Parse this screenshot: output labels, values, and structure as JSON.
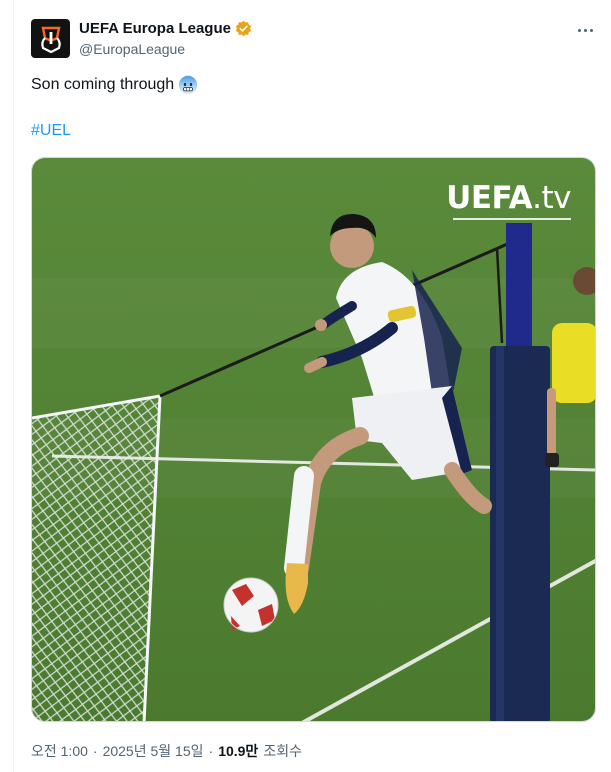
{
  "author": {
    "display_name": "UEFA Europa League",
    "handle": "@EuropaLeague",
    "verified_badge_color": "#e8a317"
  },
  "tweet": {
    "text": "Son coming through",
    "emoji": "face-with-cold-sweat-emoji",
    "hashtag": "#UEL"
  },
  "media": {
    "watermark_bold": "UEFA",
    "watermark_light": ".tv",
    "alt": "",
    "pitch_color": "#4a7a2e"
  },
  "meta": {
    "time": "오전 1:00",
    "sep1": "·",
    "date": "2025년 5월 15일",
    "sep2": "·",
    "views_count": "10.9만",
    "views_label": "조회수"
  },
  "colors": {
    "link": "#1d9bf0",
    "muted": "#536471",
    "text": "#0f1419"
  }
}
